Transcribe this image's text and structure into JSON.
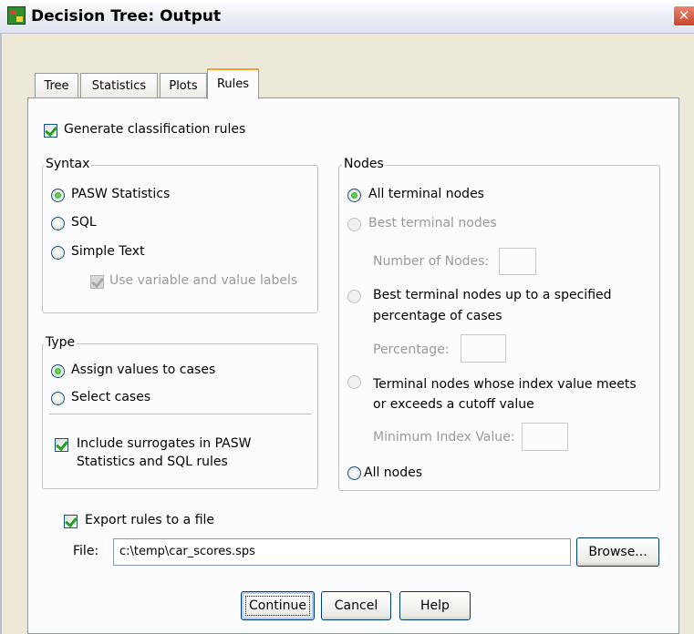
{
  "window": {
    "title": "Decision Tree: Output",
    "close_label": "✕"
  },
  "tabs": [
    {
      "label": "Tree",
      "active": false
    },
    {
      "label": "Statistics",
      "active": false
    },
    {
      "label": "Plots",
      "active": false
    },
    {
      "label": "Rules",
      "active": true
    }
  ],
  "rules": {
    "generate": {
      "label": "Generate classification rules",
      "checked": true
    },
    "syntax": {
      "legend": "Syntax",
      "options": [
        {
          "label": "PASW Statistics",
          "selected": true
        },
        {
          "label": "SQL",
          "selected": false
        },
        {
          "label": "Simple Text",
          "selected": false
        }
      ],
      "use_labels": {
        "label": "Use variable and value labels",
        "checked": true,
        "enabled": false
      }
    },
    "type": {
      "legend": "Type",
      "options": [
        {
          "label": "Assign values to cases",
          "selected": true
        },
        {
          "label": "Select cases",
          "selected": false
        }
      ],
      "surrogates_line1": "Include surrogates in PASW",
      "surrogates_line2": "Statistics and SQL rules",
      "surrogates_checked": true
    },
    "nodes": {
      "legend": "Nodes",
      "all_terminal": "All terminal nodes",
      "best_terminal": "Best terminal nodes",
      "number_of_nodes_label": "Number of Nodes:",
      "number_of_nodes_value": "",
      "best_pct_line1": "Best terminal nodes up to a specified",
      "best_pct_line2": "percentage of cases",
      "percentage_label": "Percentage:",
      "percentage_value": "",
      "index_line1": "Terminal nodes whose index value meets",
      "index_line2": "or exceeds a cutoff value",
      "min_index_label": "Minimum Index Value:",
      "min_index_value": "",
      "all_nodes": "All nodes"
    },
    "export": {
      "label": "Export rules to a file",
      "checked": true,
      "file_label": "File:",
      "file_value": "c:\\temp\\car_scores.sps",
      "browse_label": "Browse..."
    }
  },
  "buttons": {
    "continue": "Continue",
    "cancel": "Cancel",
    "help": "Help"
  },
  "colors": {
    "dialog_bg": "#ece9d8",
    "panel_bg": "#fcfcfe",
    "accent_tab": "#ff9b2a",
    "radio_check_green": "#21a121"
  }
}
